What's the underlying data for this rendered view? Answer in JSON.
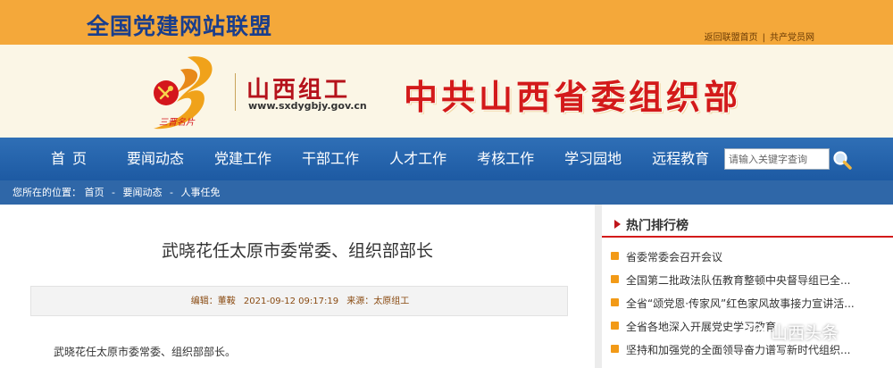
{
  "header": {
    "alliance_title": "全国党建网站联盟",
    "links": [
      "返回联盟首页",
      "共产党员网"
    ],
    "link_separator": "|"
  },
  "banner": {
    "logo_name": "山西组工",
    "logo_url": "www.sxdygbjy.gov.cn",
    "org_title": "中共山西省委组织部"
  },
  "nav": {
    "items": [
      "首页",
      "要闻动态",
      "党建工作",
      "干部工作",
      "人才工作",
      "考核工作",
      "学习园地",
      "远程教育"
    ],
    "search_placeholder": "请输入关键字查询"
  },
  "breadcrumb": {
    "prefix": "您所在的位置：",
    "items": [
      "首页",
      "要闻动态",
      "人事任免"
    ],
    "separator": "-"
  },
  "article": {
    "title": "武晓花任太原市委常委、组织部部长",
    "editor": "编辑：董鞍",
    "datetime": "2021-09-12 09:17:19",
    "source": "来源：太原组工",
    "body": "武晓花任太原市委常委、组织部部长。"
  },
  "sidebar": {
    "hot_title": "热门排行榜",
    "hot_items": [
      "省委常委会召开会议",
      "全国第二批政法队伍教育整顿中央督导组已全...",
      "全省“颂党恩·传家风”红色家风故事接力宣讲活...",
      "全省各地深入开展党史学习教育",
      "坚持和加强党的全面领导奋力谱写新时代组织..."
    ]
  },
  "watermark": {
    "text": "山西头条"
  },
  "colors": {
    "top_bar": "#f4a83a",
    "alliance_title": "#1a3e8c",
    "nav_bg": "#1d5aa3",
    "org_title_red": "#d31a1a",
    "hot_bullet": "#f29a17"
  }
}
